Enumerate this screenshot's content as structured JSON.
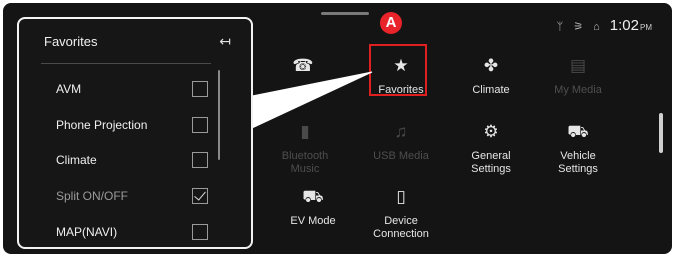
{
  "status": {
    "icons": [
      "signal-icon",
      "no-data-icon",
      "phone-icon"
    ],
    "time": "1:02",
    "ampm": "PM"
  },
  "marker": "A",
  "menu": {
    "row1": [
      {
        "label": "Favorites",
        "icon": "star-icon",
        "glyph": "★",
        "dim": false
      },
      {
        "label": "Climate",
        "icon": "fan-icon",
        "glyph": "✤",
        "dim": false
      },
      {
        "label": "My Media",
        "icon": "media-icon",
        "glyph": "▤",
        "dim": true
      }
    ],
    "row2": [
      {
        "label": "Bluetooth Music",
        "icon": "bluetooth-icon",
        "glyph": "▮",
        "dim": true
      },
      {
        "label": "USB Media",
        "icon": "music-icon",
        "glyph": "♫",
        "dim": true
      },
      {
        "label": "General Settings",
        "icon": "gear-icon",
        "glyph": "⚙",
        "dim": false
      },
      {
        "label": "Vehicle Settings",
        "icon": "car-settings-icon",
        "glyph": "⛟",
        "dim": false
      }
    ],
    "row3": [
      {
        "label": "EV Mode",
        "icon": "ev-car-icon",
        "glyph": "⛟",
        "dim": false
      },
      {
        "label": "Device Connection",
        "icon": "device-connection-icon",
        "glyph": "▯",
        "dim": false
      }
    ],
    "phone_icon": "☎"
  },
  "favorites_panel": {
    "title": "Favorites",
    "back_glyph": "↤",
    "items": [
      {
        "label": "AVM",
        "checked": false,
        "grey": false
      },
      {
        "label": "Phone Projection",
        "checked": false,
        "grey": false
      },
      {
        "label": "Climate",
        "checked": false,
        "grey": false
      },
      {
        "label": "Split ON/OFF",
        "checked": true,
        "grey": true
      },
      {
        "label": "MAP(NAVI)",
        "checked": false,
        "grey": false
      }
    ]
  }
}
